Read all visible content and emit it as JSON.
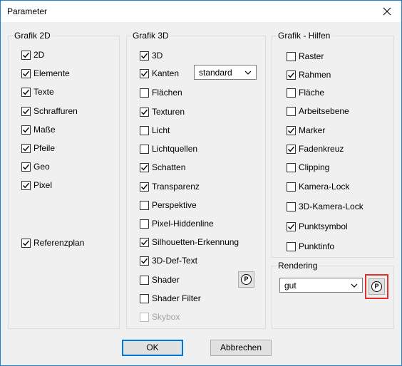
{
  "window": {
    "title": "Parameter",
    "close_icon": "close-icon"
  },
  "grafik2d": {
    "label": "Grafik 2D",
    "items": [
      {
        "label": "2D",
        "checked": true
      },
      {
        "label": "Elemente",
        "checked": true
      },
      {
        "label": "Texte",
        "checked": true
      },
      {
        "label": "Schraffuren",
        "checked": true
      },
      {
        "label": "Maße",
        "checked": true
      },
      {
        "label": "Pfeile",
        "checked": true
      },
      {
        "label": "Geo",
        "checked": true
      },
      {
        "label": "Pixel",
        "checked": true
      },
      {
        "label": "Referenzplan",
        "checked": true
      }
    ]
  },
  "grafik3d": {
    "label": "Grafik 3D",
    "kanten_select": "standard",
    "items": [
      {
        "label": "3D",
        "checked": true
      },
      {
        "label": "Kanten",
        "checked": true
      },
      {
        "label": "Flächen",
        "checked": false
      },
      {
        "label": "Texturen",
        "checked": true
      },
      {
        "label": "Licht",
        "checked": false
      },
      {
        "label": "Lichtquellen",
        "checked": false
      },
      {
        "label": "Schatten",
        "checked": true
      },
      {
        "label": "Transparenz",
        "checked": true
      },
      {
        "label": "Perspektive",
        "checked": false
      },
      {
        "label": "Pixel-Hiddenline",
        "checked": false
      },
      {
        "label": "Silhouetten-Erkennung",
        "checked": true
      },
      {
        "label": "3D-Def-Text",
        "checked": true
      },
      {
        "label": "Shader",
        "checked": false
      },
      {
        "label": "Shader Filter",
        "checked": false
      },
      {
        "label": "Skybox",
        "checked": false,
        "disabled": true
      }
    ],
    "p_button": "P"
  },
  "hilfen": {
    "label": "Grafik - Hilfen",
    "items": [
      {
        "label": "Raster",
        "checked": false
      },
      {
        "label": "Rahmen",
        "checked": true
      },
      {
        "label": "Fläche",
        "checked": false
      },
      {
        "label": "Arbeitsebene",
        "checked": false
      },
      {
        "label": "Marker",
        "checked": true
      },
      {
        "label": "Fadenkreuz",
        "checked": true
      },
      {
        "label": "Clipping",
        "checked": false
      },
      {
        "label": "Kamera-Lock",
        "checked": false
      },
      {
        "label": "3D-Kamera-Lock",
        "checked": false
      },
      {
        "label": "Punktsymbol",
        "checked": true
      },
      {
        "label": "Punktinfo",
        "checked": false
      }
    ]
  },
  "rendering": {
    "label": "Rendering",
    "select": "gut",
    "p_button": "P"
  },
  "buttons": {
    "ok": "OK",
    "cancel": "Abbrechen"
  },
  "colors": {
    "title_border": "#1883d7",
    "highlight": "#e0302e"
  }
}
